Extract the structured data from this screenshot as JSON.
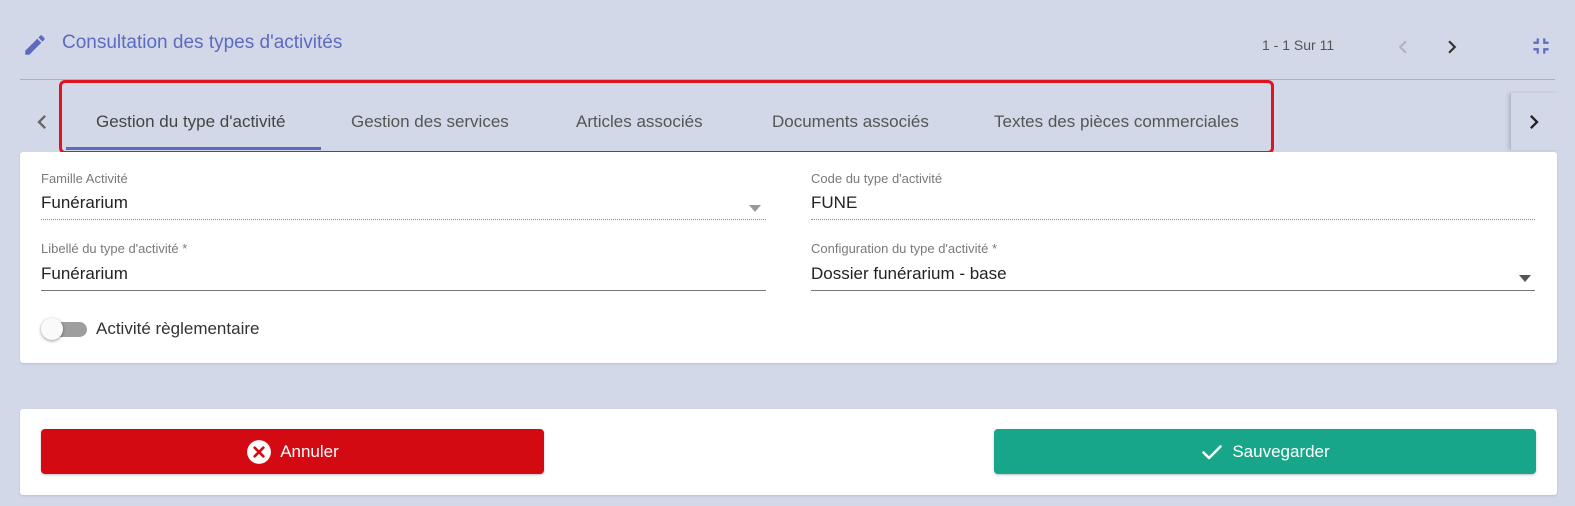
{
  "header": {
    "title": "Consultation des types d'activités",
    "pager": "1 - 1 Sur 11",
    "icons": {
      "edit": "pencil-icon",
      "prev": "chevron-left-icon",
      "next": "chevron-right-icon",
      "collapse": "collapse-icon"
    }
  },
  "tabs": {
    "items": [
      {
        "label": "Gestion du type d'activité",
        "active": true
      },
      {
        "label": "Gestion des services",
        "active": false
      },
      {
        "label": "Articles associés",
        "active": false
      },
      {
        "label": "Documents associés",
        "active": false
      },
      {
        "label": "Textes des pièces commerciales",
        "active": false
      }
    ]
  },
  "form": {
    "famille": {
      "label": "Famille Activité",
      "value": "Funérarium"
    },
    "code": {
      "label": "Code du type d'activité",
      "value": "FUNE"
    },
    "libelle": {
      "label": "Libellé du type d'activité *",
      "value": "Funérarium"
    },
    "config": {
      "label": "Configuration du type d'activité *",
      "value": "Dossier funérarium - base"
    },
    "reglementaire": {
      "label": "Activité règlementaire",
      "checked": false
    }
  },
  "actions": {
    "cancel_label": "Annuler",
    "save_label": "Sauvegarder"
  },
  "colors": {
    "accent": "#5c6bc0",
    "background": "#d3d8e8",
    "cancel": "#d40a12",
    "save": "#17a68a",
    "highlight": "#e0141e"
  }
}
